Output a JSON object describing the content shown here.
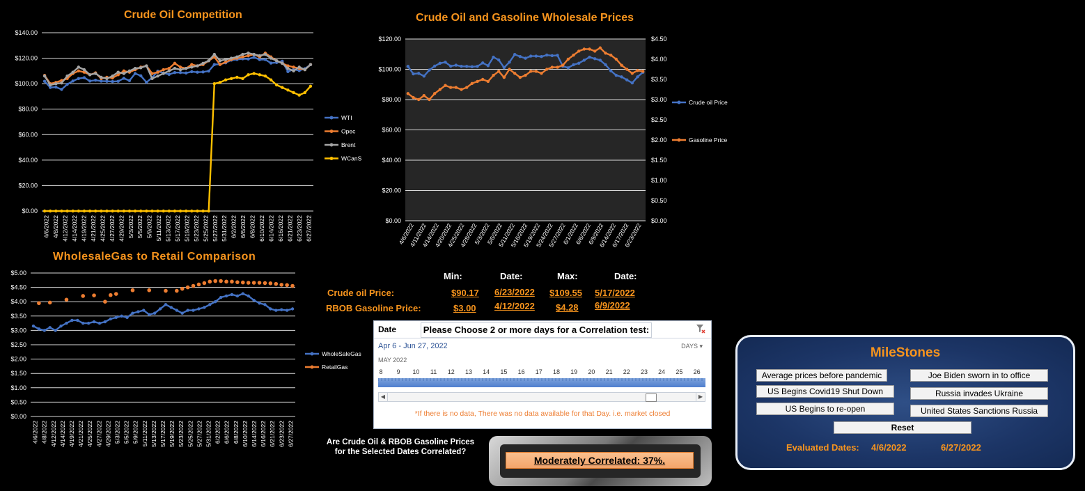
{
  "colors": {
    "wti": "#4472c4",
    "opec": "#ed7d31",
    "brent": "#a5a5a5",
    "wcans": "#ffc000",
    "accent": "#f7941d",
    "milestone_bg": "#1c3566"
  },
  "chart_data": [
    {
      "id": "crude-competition",
      "type": "line",
      "title": "Crude Oil Competition",
      "ylim": [
        0,
        140
      ],
      "yticks": [
        "$0.00",
        "$20.00",
        "$40.00",
        "$60.00",
        "$80.00",
        "$100.00",
        "$120.00",
        "$140.00"
      ],
      "grid": true,
      "legend_position": "right",
      "x_tick_labels": [
        "4/6/2022",
        "4/8/2022",
        "4/12/2022",
        "4/14/2022",
        "4/19/2022",
        "4/21/2022",
        "4/25/2022",
        "4/27/2022",
        "4/29/2022",
        "5/3/2022",
        "5/5/2022",
        "5/9/2022",
        "5/11/2022",
        "5/13/2022",
        "5/17/2022",
        "5/19/2022",
        "5/23/2022",
        "5/25/2022",
        "5/27/2022",
        "5/31/2022",
        "6/2/2022",
        "6/6/2022",
        "6/8/2022",
        "6/10/2022",
        "6/14/2022",
        "6/16/2022",
        "6/21/2022",
        "6/23/2022",
        "6/27/2022"
      ],
      "series": [
        {
          "name": "WTI",
          "color": "#4472c4",
          "values": [
            101.9,
            97.0,
            97.3,
            95.5,
            99.5,
            102.1,
            104.0,
            104.7,
            102.1,
            102.7,
            102.0,
            101.9,
            101.7,
            101.9,
            104.2,
            102.4,
            108.0,
            106.2,
            101.1,
            104.7,
            109.8,
            108.4,
            107.3,
            108.7,
            108.7,
            108.4,
            109.4,
            109.0,
            109.2,
            109.9,
            115.0,
            115.3,
            116.4,
            118.5,
            119.0,
            119.5,
            119.4,
            120.7,
            118.9,
            118.9,
            116.2,
            116.6,
            117.6,
            109.5,
            111.2,
            110.3,
            111.8,
            114.9
          ]
        },
        {
          "name": "Opec",
          "color": "#ed7d31",
          "values": [
            106.5,
            100.0,
            101.0,
            102.5,
            104.0,
            108.0,
            110.0,
            109.0,
            107.0,
            108.5,
            104.0,
            105.0,
            104.5,
            107.0,
            110.0,
            109.0,
            111.0,
            113.0,
            114.0,
            108.0,
            109.0,
            111.0,
            112.0,
            116.0,
            113.0,
            112.0,
            115.0,
            114.0,
            115.0,
            118.0,
            121.0,
            115.0,
            117.0,
            119.0,
            120.0,
            121.0,
            122.0,
            123.0,
            121.0,
            124.0,
            121.0,
            118.0,
            116.0,
            114.0,
            113.0,
            112.0,
            111.0,
            115.0
          ]
        },
        {
          "name": "Brent",
          "color": "#a5a5a5",
          "values": [
            106.0,
            99.0,
            100.0,
            100.5,
            106.0,
            109.0,
            113.0,
            111.0,
            107.0,
            108.0,
            105.0,
            104.0,
            106.0,
            109.0,
            108.0,
            110.0,
            112.0,
            112.5,
            114.0,
            104.0,
            106.0,
            108.0,
            110.0,
            112.0,
            111.0,
            112.0,
            113.0,
            114.0,
            116.0,
            118.0,
            123.0,
            118.0,
            119.0,
            120.0,
            121.0,
            123.0,
            124.0,
            123.0,
            122.0,
            123.0,
            120.0,
            118.0,
            116.0,
            112.0,
            110.0,
            113.0,
            111.0,
            115.0
          ]
        },
        {
          "name": "WCanS",
          "color": "#ffc000",
          "values": [
            0,
            0,
            0,
            0,
            0,
            0,
            0,
            0,
            0,
            0,
            0,
            0,
            0,
            0,
            0,
            0,
            0,
            0,
            0,
            0,
            0,
            0,
            0,
            0,
            0,
            0,
            0,
            0,
            0,
            0,
            100.0,
            101.0,
            103.0,
            104.0,
            105.0,
            104.0,
            107.0,
            108.0,
            107.0,
            106.0,
            103.0,
            99.0,
            97.0,
            95.0,
            93.0,
            91.0,
            93.0,
            98.0
          ]
        }
      ]
    },
    {
      "id": "crude-gasoline",
      "type": "line",
      "title": "Crude Oil and Gasoline Wholesale Prices",
      "ylim_left": [
        0,
        120
      ],
      "ylim_right": [
        0,
        4.5
      ],
      "yticks_left": [
        "$0.00",
        "$20.00",
        "$40.00",
        "$60.00",
        "$80.00",
        "$100.00",
        "$120.00"
      ],
      "yticks_right": [
        "$0.00",
        "$0.50",
        "$1.00",
        "$1.50",
        "$2.00",
        "$2.50",
        "$3.00",
        "$3.50",
        "$4.00",
        "$4.50"
      ],
      "grid": true,
      "legend_position": "right",
      "x_tick_labels": [
        "4/6/2022",
        "4/11/2022",
        "4/14/2022",
        "4/20/2022",
        "4/25/2022",
        "4/28/2022",
        "5/3/2022",
        "5/6/2022",
        "5/11/2022",
        "5/16/2022",
        "5/19/2022",
        "5/24/2022",
        "5/27/2022",
        "6/1/2022",
        "6/6/2022",
        "6/9/2022",
        "6/14/2022",
        "6/17/2022",
        "6/23/2022"
      ],
      "series": [
        {
          "name": "Crude oil Price",
          "axis": "left",
          "color": "#4472c4",
          "values": [
            101.9,
            97.0,
            97.3,
            95.5,
            99.5,
            102.1,
            104.0,
            104.7,
            102.1,
            102.7,
            102.0,
            101.9,
            101.7,
            101.9,
            104.2,
            102.4,
            108.0,
            106.2,
            101.1,
            104.7,
            109.8,
            108.4,
            107.3,
            108.7,
            108.7,
            108.4,
            109.4,
            109.0,
            109.2,
            102.0,
            101.0,
            103.0,
            104.0,
            106.0,
            108.0,
            107.0,
            106.0,
            103.0,
            99.0,
            96.0,
            95.0,
            93.0,
            91.0,
            95.0,
            98.0
          ]
        },
        {
          "name": "Gasoline Price",
          "axis": "right",
          "color": "#ed7d31",
          "values": [
            3.15,
            3.05,
            3.0,
            3.1,
            3.0,
            3.15,
            3.25,
            3.35,
            3.3,
            3.3,
            3.25,
            3.3,
            3.4,
            3.45,
            3.5,
            3.45,
            3.6,
            3.7,
            3.55,
            3.75,
            3.65,
            3.55,
            3.6,
            3.7,
            3.7,
            3.65,
            3.75,
            3.8,
            3.8,
            3.85,
            4.0,
            4.1,
            4.2,
            4.25,
            4.25,
            4.2,
            4.28,
            4.15,
            4.1,
            4.0,
            3.85,
            3.75,
            3.65,
            3.72,
            3.7
          ]
        }
      ]
    },
    {
      "id": "wholesale-retail",
      "type": "line",
      "title": "WholesaleGas to Retail Comparison",
      "ylim": [
        0,
        5
      ],
      "yticks": [
        "$0.00",
        "$0.50",
        "$1.00",
        "$1.50",
        "$2.00",
        "$2.50",
        "$3.00",
        "$3.50",
        "$4.00",
        "$4.50",
        "$5.00"
      ],
      "grid": true,
      "legend_position": "right",
      "x_tick_labels": [
        "4/6/2022",
        "4/8/2022",
        "4/12/2022",
        "4/14/2022",
        "4/19/2022",
        "4/21/2022",
        "4/25/2022",
        "4/27/2022",
        "4/29/2022",
        "5/3/2022",
        "5/5/2022",
        "5/9/2022",
        "5/11/2022",
        "5/13/2022",
        "5/17/2022",
        "5/19/2022",
        "5/23/2022",
        "5/25/2022",
        "5/27/2022",
        "5/31/2022",
        "6/2/2022",
        "6/6/2022",
        "6/8/2022",
        "6/10/2022",
        "6/14/2022",
        "6/16/2022",
        "6/21/2022",
        "6/23/2022",
        "6/27/2022"
      ],
      "series": [
        {
          "name": "WholeSaleGas",
          "color": "#4472c4",
          "values": [
            3.15,
            3.05,
            3.0,
            3.1,
            3.0,
            3.15,
            3.25,
            3.35,
            3.35,
            3.25,
            3.25,
            3.3,
            3.25,
            3.3,
            3.4,
            3.45,
            3.5,
            3.45,
            3.6,
            3.65,
            3.7,
            3.55,
            3.6,
            3.75,
            3.9,
            3.8,
            3.7,
            3.6,
            3.7,
            3.7,
            3.75,
            3.8,
            3.9,
            4.0,
            4.15,
            4.2,
            4.25,
            4.2,
            4.28,
            4.2,
            4.05,
            3.95,
            3.9,
            3.75,
            3.7,
            3.72,
            3.7,
            3.75
          ]
        },
        {
          "name": "RetailGas",
          "color": "#ed7d31",
          "points": [
            [
              1,
              3.95
            ],
            [
              3,
              3.97
            ],
            [
              6,
              4.07
            ],
            [
              9,
              4.2
            ],
            [
              11,
              4.22
            ],
            [
              13,
              4.0
            ],
            [
              14,
              4.23
            ],
            [
              15,
              4.27
            ],
            [
              18,
              4.4
            ],
            [
              21,
              4.4
            ],
            [
              24,
              4.38
            ],
            [
              26,
              4.38
            ],
            [
              27,
              4.45
            ],
            [
              28,
              4.5
            ],
            [
              29,
              4.55
            ],
            [
              30,
              4.6
            ],
            [
              31,
              4.65
            ],
            [
              32,
              4.7
            ],
            [
              33,
              4.72
            ],
            [
              34,
              4.72
            ],
            [
              35,
              4.7
            ],
            [
              36,
              4.7
            ],
            [
              37,
              4.68
            ],
            [
              38,
              4.67
            ],
            [
              39,
              4.66
            ],
            [
              40,
              4.66
            ],
            [
              41,
              4.66
            ],
            [
              42,
              4.65
            ],
            [
              43,
              4.64
            ],
            [
              44,
              4.62
            ],
            [
              45,
              4.59
            ],
            [
              46,
              4.58
            ],
            [
              47,
              4.55
            ]
          ]
        }
      ]
    }
  ],
  "stats": {
    "headers": {
      "min": "Min:",
      "date1": "Date:",
      "max": "Max:",
      "date2": "Date:"
    },
    "crude": {
      "label": "Crude oil Price:",
      "min": "$90.17",
      "min_date": "6/23/2022",
      "max": "$109.55",
      "max_date": "5/17/2022"
    },
    "gas": {
      "label": "RBOB Gasoline Price:",
      "min": "$3.00",
      "min_date": "4/12/2022",
      "max": "$4.28",
      "max_date": "6/9/2022"
    }
  },
  "slicer": {
    "field": "Date",
    "prompt": "Please Choose 2 or more days for a Correlation test:",
    "range": "Apr 6 - Jun 27, 2022",
    "unit": "DAYS",
    "month": "MAY 2022",
    "days": [
      "8",
      "9",
      "10",
      "11",
      "12",
      "13",
      "14",
      "15",
      "16",
      "17",
      "18",
      "19",
      "20",
      "21",
      "22",
      "23",
      "24",
      "25",
      "26"
    ],
    "note": "*If there is no data, There was no data available for that Day. i.e. market closed"
  },
  "correlation": {
    "question_line1": "Are Crude Oil & RBOB Gasoline Prices",
    "question_line2": "for the Selected Dates Correlated?",
    "result": "Moderately Correlated: 37%."
  },
  "milestones": {
    "title": "MileStones",
    "buttons": [
      "Average prices before pandemic",
      "Joe Biden sworn in to office",
      "US  Begins Covid19 Shut Down",
      "Russia invades Ukraine",
      "US Begins to re-open",
      "United States Sanctions Russia"
    ],
    "reset": "Reset",
    "evaluated_label": "Evaluated Dates:",
    "start": "4/6/2022",
    "end": "6/27/2022"
  }
}
